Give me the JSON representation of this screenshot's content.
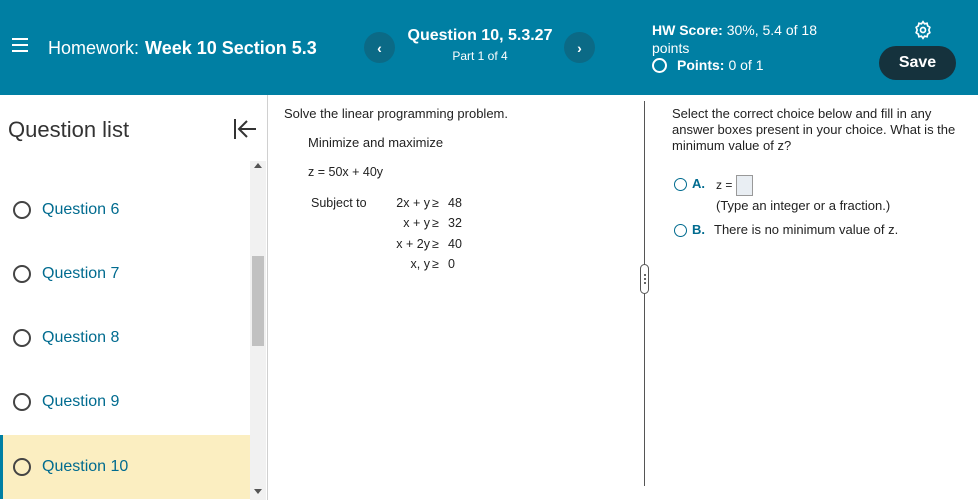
{
  "header": {
    "homework_label": "Homework:",
    "homework_name": "Week 10 Section 5.3",
    "question_title": "Question 10, 5.3.27",
    "question_part": "Part 1 of 4",
    "prev_symbol": "‹",
    "next_symbol": "›",
    "hw_score_label": "HW Score:",
    "hw_score_value": "30%, 5.4 of 18 points",
    "points_label": "Points:",
    "points_value": "0 of 1",
    "save_label": "Save",
    "colors": {
      "header_bg": "#007fa3",
      "save_bg": "#15323d"
    }
  },
  "sidebar": {
    "title": "Question list",
    "items": [
      {
        "label": "Question 6"
      },
      {
        "label": "Question 7"
      },
      {
        "label": "Question 8"
      },
      {
        "label": "Question 9"
      },
      {
        "label": "Question 10",
        "active": true
      }
    ]
  },
  "problem": {
    "intro": "Solve the linear programming problem.",
    "task": "Minimize and maximize",
    "objective": "z = 50x + 40y",
    "subject_to": "Subject to",
    "constraints": [
      {
        "lhs": "2x + y",
        "rel": "≥",
        "rhs": "48"
      },
      {
        "lhs": "x + y",
        "rel": "≥",
        "rhs": "32"
      },
      {
        "lhs": "x + 2y",
        "rel": "≥",
        "rhs": "40"
      },
      {
        "lhs": "x, y",
        "rel": "≥",
        "rhs": "0"
      }
    ]
  },
  "answer": {
    "instruction": "Select the correct choice below and fill in any answer boxes present in your choice. What is the minimum value of z?",
    "choice_a_letter": "A.",
    "choice_a_eq": "z =",
    "choice_a_value": "",
    "choice_a_hint": "(Type an integer or a fraction.)",
    "choice_b_letter": "B.",
    "choice_b_text": "There is no minimum value of z."
  }
}
